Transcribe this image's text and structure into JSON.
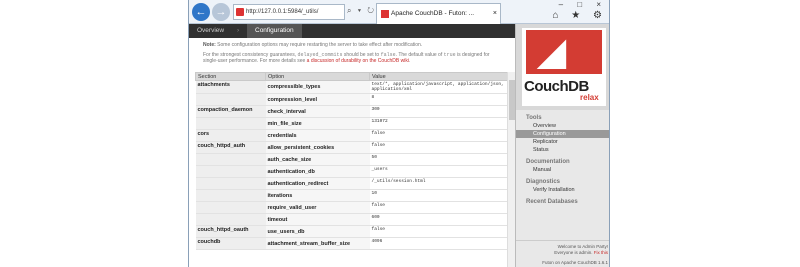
{
  "browser": {
    "address": "http://127.0.0.1:5984/_utils/",
    "address_icons": "⌕ ▾ ↻",
    "tab_title": "Apache CouchDB - Futon: ...",
    "tab_close": "×",
    "window_controls": "– □ ×",
    "tool_icons": "⌂ ★ ⚙"
  },
  "breadcrumb": {
    "overview": "Overview",
    "separator": "›",
    "current": "Configuration"
  },
  "notes": {
    "restart_label": "Note:",
    "restart_text": "Some configuration options may require restarting the server to take effect after modification.",
    "p2_a": "For the strongest consistency guarantees,",
    "p2_code1": "delayed_commits",
    "p2_b": "should be set to",
    "p2_code2": "false",
    "p2_c": ". The default value of",
    "p2_code3": "true",
    "p2_d": "is designed for single-user performance. For more details see",
    "p2_link": "a discussion of durability on the CouchDB wiki",
    "p2_e": "."
  },
  "table": {
    "headers": [
      "Section",
      "Option",
      "Value"
    ],
    "rows": [
      {
        "section": "attachments",
        "option": "compressible_types",
        "value": "text/*, application/javascript, application/json, application/xml"
      },
      {
        "section": "",
        "option": "compression_level",
        "value": "8"
      },
      {
        "section": "compaction_daemon",
        "option": "check_interval",
        "value": "300"
      },
      {
        "section": "",
        "option": "min_file_size",
        "value": "131072"
      },
      {
        "section": "cors",
        "option": "credentials",
        "value": "false"
      },
      {
        "section": "couch_httpd_auth",
        "option": "allow_persistent_cookies",
        "value": "false"
      },
      {
        "section": "",
        "option": "auth_cache_size",
        "value": "50"
      },
      {
        "section": "",
        "option": "authentication_db",
        "value": "_users"
      },
      {
        "section": "",
        "option": "authentication_redirect",
        "value": "/_utils/session.html"
      },
      {
        "section": "",
        "option": "iterations",
        "value": "10"
      },
      {
        "section": "",
        "option": "require_valid_user",
        "value": "false"
      },
      {
        "section": "",
        "option": "timeout",
        "value": "600"
      },
      {
        "section": "couch_httpd_oauth",
        "option": "use_users_db",
        "value": "false"
      },
      {
        "section": "couchdb",
        "option": "attachment_stream_buffer_size",
        "value": "4096"
      }
    ]
  },
  "sidebar": {
    "logo_name": "CouchDB",
    "logo_tag": "relax",
    "tools_heading": "Tools",
    "tools": [
      "Overview",
      "Configuration",
      "Replicator",
      "Status"
    ],
    "doc_heading": "Documentation",
    "docs": [
      "Manual"
    ],
    "diag_heading": "Diagnostics",
    "diags": [
      "Verify Installation"
    ],
    "recent_heading": "Recent Databases",
    "welcome": "Welcome to Admin Party!",
    "everyone": "Everyone is admin.",
    "fix": "Fix this",
    "version": "Futon on Apache CouchDB 1.6.1"
  },
  "colors": {
    "accent": "#d33c33",
    "topbar": "#303030"
  }
}
